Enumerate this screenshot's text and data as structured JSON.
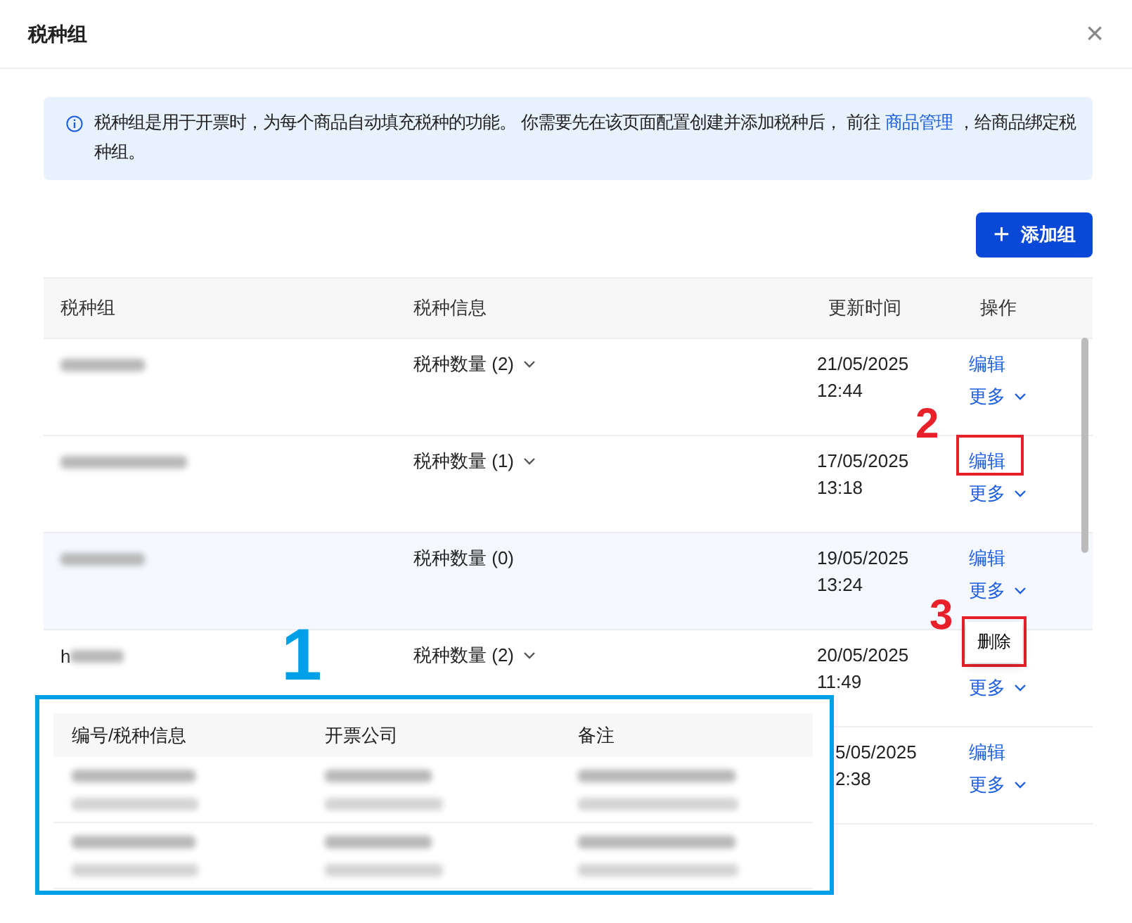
{
  "dialog": {
    "title": "税种组",
    "close": "×"
  },
  "notice": {
    "before": "税种组是用于开票时，为每个商品自动填充税种的功能。 你需要先在该页面配置创建并添加税种后， 前往 ",
    "link": "商品管理",
    "after": " ，给商品绑定税种组。"
  },
  "add_button": {
    "icon": "+",
    "label": "添加组"
  },
  "table": {
    "columns": [
      "税种组",
      "税种信息",
      "更新时间",
      "操作"
    ],
    "rows": [
      {
        "name_redacted": true,
        "tax_count": "税种数量 (2)",
        "expandable": true,
        "date": "21/05/2025",
        "time": "12:44",
        "edit": "编辑",
        "more": "更多",
        "hovered": false
      },
      {
        "name_redacted": true,
        "tax_count": "税种数量 (1)",
        "expandable": true,
        "date": "17/05/2025",
        "time": "13:18",
        "edit": "编辑",
        "more": "更多",
        "hovered": false
      },
      {
        "name_redacted": true,
        "tax_count": "税种数量 (0)",
        "expandable": false,
        "date": "19/05/2025",
        "time": "13:24",
        "edit": "编辑",
        "more": "更多",
        "hovered": true
      },
      {
        "name_redacted": true,
        "name_visible": "h",
        "tax_count": "税种数量 (2)",
        "expandable": true,
        "date": "20/05/2025",
        "time": "11:49",
        "more": "更多",
        "hovered": false
      },
      {
        "covered_by_popup": true,
        "date": "5/05/2025",
        "time": "2:38",
        "edit": "编辑",
        "more": "更多",
        "hovered": false
      }
    ]
  },
  "more_menu": {
    "items": [
      "删除"
    ]
  },
  "detail_popup": {
    "columns": [
      "编号/税种信息",
      "开票公司",
      "备注"
    ],
    "rows": [
      {
        "kind": "redacted"
      },
      {
        "kind": "redacted"
      }
    ]
  },
  "annotations": [
    {
      "label": "1",
      "color": "#00a0e9"
    },
    {
      "label": "2",
      "color": "#e8202a"
    },
    {
      "label": "3",
      "color": "#e8202a"
    }
  ]
}
